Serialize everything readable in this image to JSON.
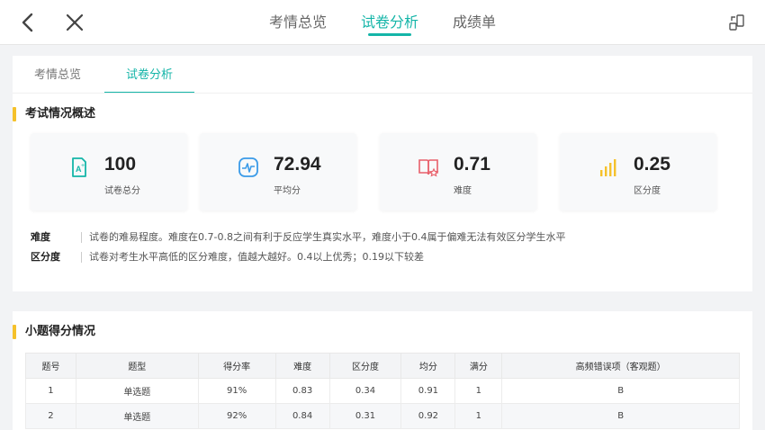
{
  "topbar": {
    "tabs": [
      {
        "label": "考情总览",
        "active": false
      },
      {
        "label": "试卷分析",
        "active": true
      },
      {
        "label": "成绩单",
        "active": false
      }
    ]
  },
  "subtabs": [
    {
      "label": "考情总览",
      "active": false
    },
    {
      "label": "试卷分析",
      "active": true
    }
  ],
  "overview": {
    "title": "考试情况概述",
    "stats": [
      {
        "value": "100",
        "label": "试卷总分",
        "icon": "paper-score-icon",
        "color": "#14b5a8"
      },
      {
        "value": "72.94",
        "label": "平均分",
        "icon": "pulse-icon",
        "color": "#3b9be8"
      },
      {
        "value": "0.71",
        "label": "难度",
        "icon": "book-star-icon",
        "color": "#e8606b"
      },
      {
        "value": "0.25",
        "label": "区分度",
        "icon": "bar-signal-icon",
        "color": "#f5c12b"
      }
    ],
    "definitions": [
      {
        "term": "难度",
        "text": "试卷的难易程度。难度在0.7-0.8之间有利于反应学生真实水平，难度小于0.4属于偏难无法有效区分学生水平"
      },
      {
        "term": "区分度",
        "text": "试卷对考生水平高低的区分难度，值越大越好。0.4以上优秀；0.19以下较差"
      }
    ]
  },
  "questions": {
    "title": "小题得分情况",
    "headers": [
      "题号",
      "题型",
      "得分率",
      "难度",
      "区分度",
      "均分",
      "满分",
      "高频错误项（客观题）"
    ],
    "rows": [
      [
        "1",
        "单选题",
        "91%",
        "0.83",
        "0.34",
        "0.91",
        "1",
        "B"
      ],
      [
        "2",
        "单选题",
        "92%",
        "0.84",
        "0.31",
        "0.92",
        "1",
        "B"
      ]
    ]
  },
  "colors": {
    "accent": "#14b5a8",
    "section_marker": "#f5c12b"
  }
}
